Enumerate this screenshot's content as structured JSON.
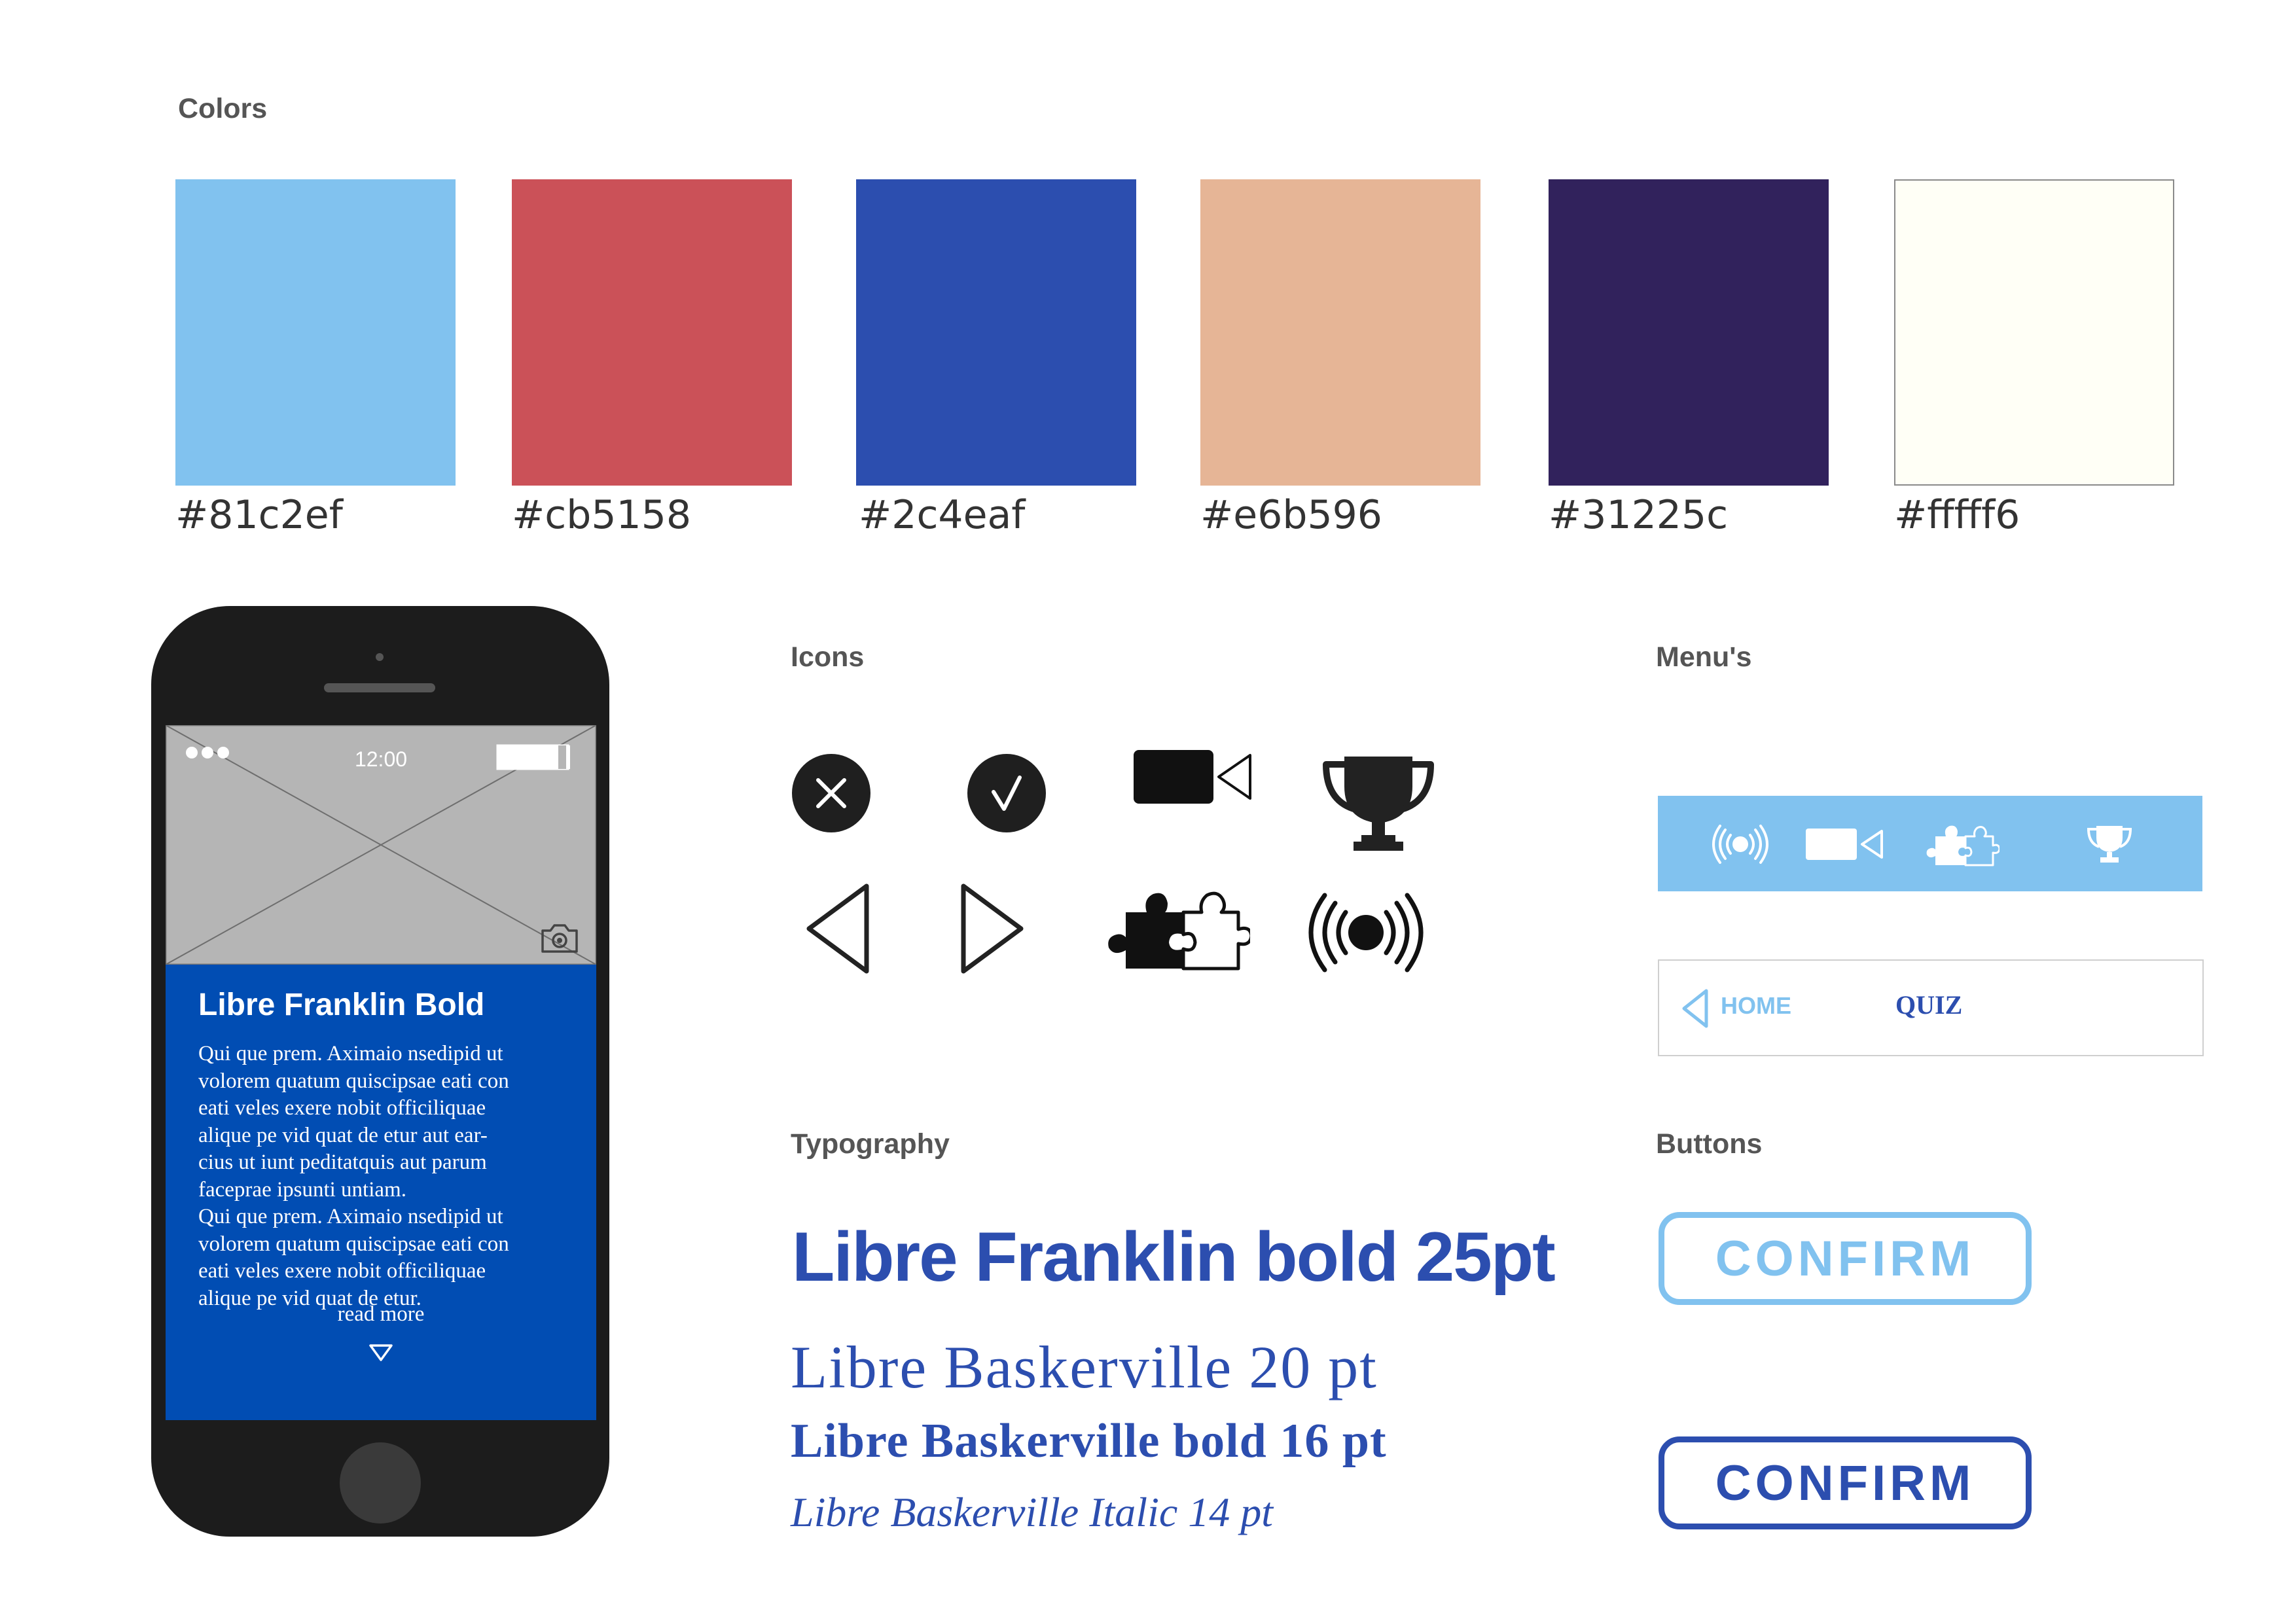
{
  "sections": {
    "colors": "Colors",
    "icons": "Icons",
    "menus": "Menu's",
    "typography": "Typography",
    "buttons": "Buttons"
  },
  "palette": [
    {
      "hex": "#81c2ef",
      "label": "#81c2ef"
    },
    {
      "hex": "#cb5158",
      "label": "#cb5158"
    },
    {
      "hex": "#2c4eaf",
      "label": "#2c4eaf"
    },
    {
      "hex": "#e6b596",
      "label": "#e6b596"
    },
    {
      "hex": "#31225c",
      "label": "#31225c"
    },
    {
      "hex": "#fffff6",
      "label": "#fffff6"
    }
  ],
  "phone": {
    "status_time": "12:00",
    "heading": "Libre Franklin Bold",
    "body": "Qui que prem. Aximaio nsedipid ut\nvolorem quatum quiscipsae eati con\neati veles exere nobit officiliquae\nalique pe vid quat de etur aut ear-\ncius ut iunt peditatquis aut parum\nfaceprae ipsunti untiam.\nQui que prem. Aximaio nsedipid ut\nvolorem quatum quiscipsae eati con\neati veles exere nobit officiliquae\nalique pe vid quat de etur.",
    "read_more": "read more"
  },
  "icons": [
    "close-icon",
    "check-icon",
    "video-camera-icon",
    "trophy-icon",
    "arrow-left-icon",
    "arrow-right-icon",
    "puzzle-icon",
    "broadcast-icon"
  ],
  "menus": {
    "bar_icons": [
      "broadcast-icon",
      "video-camera-icon",
      "puzzle-icon",
      "trophy-icon"
    ],
    "nav_home": "HOME",
    "nav_quiz": "QUIZ"
  },
  "typography": {
    "franklin": "Libre Franklin bold 25pt",
    "bask20": "Libre Baskerville 20 pt",
    "bask16": "Libre Baskerville bold 16 pt",
    "bask14": "Libre Baskerville Italic 14 pt"
  },
  "buttons": {
    "confirm_light": "CONFIRM",
    "confirm_dark": "CONFIRM"
  },
  "accent_colors": {
    "light": "#81c2ef",
    "dark": "#2c4eaf",
    "phone_screen": "#014db3"
  }
}
